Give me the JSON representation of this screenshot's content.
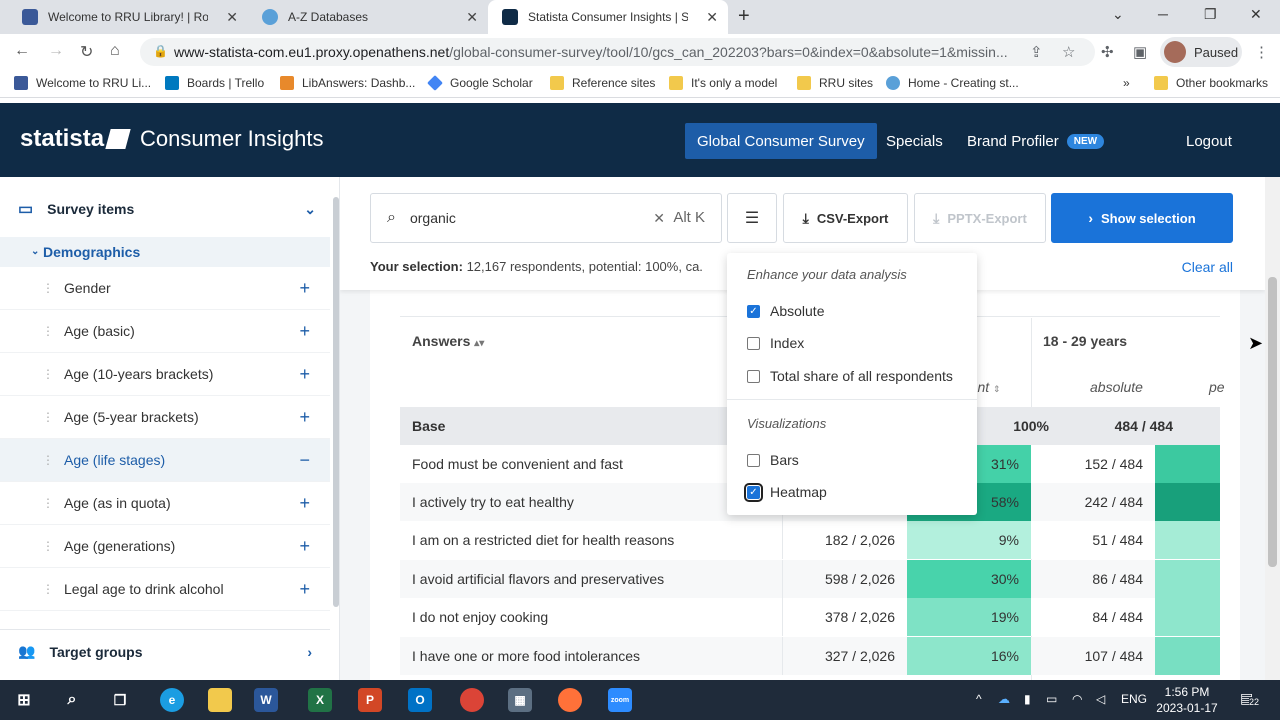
{
  "browser": {
    "tabs": [
      {
        "title": "Welcome to RRU Library! | Royal",
        "color": "#3b5998"
      },
      {
        "title": "A-Z Databases",
        "color": "#5aa0d8"
      },
      {
        "title": "Statista Consumer Insights | Stati",
        "color": "#0f2b46"
      }
    ],
    "url_domain": "www-statista-com.eu1.proxy.openathens.net",
    "url_path": "/global-consumer-survey/tool/10/gcs_can_202203?bars=0&index=0&absolute=1&missin...",
    "profile_label": "Paused",
    "bookmarks": [
      {
        "label": "Welcome to RRU Li...",
        "color": "#3b5998"
      },
      {
        "label": "Boards | Trello",
        "color": "#0079bf"
      },
      {
        "label": "LibAnswers: Dashb...",
        "color": "#e8892b"
      },
      {
        "label": "Google Scholar",
        "color": "#4285f4"
      },
      {
        "label": "Reference sites",
        "color": "#f2c94c"
      },
      {
        "label": "It's only a model",
        "color": "#f2c94c"
      },
      {
        "label": "RRU sites",
        "color": "#f2c94c"
      },
      {
        "label": "Home - Creating st...",
        "color": "#5aa0d8"
      }
    ],
    "more_bookmarks": "»",
    "other_bookmarks": "Other bookmarks"
  },
  "header": {
    "brand": "statista",
    "product": "Consumer Insights",
    "nav": [
      "Global Consumer Survey",
      "Specials",
      "Brand Profiler"
    ],
    "new_badge": "NEW",
    "logout": "Logout"
  },
  "sidebar": {
    "survey_items": "Survey items",
    "category": "Demographics",
    "items": [
      {
        "label": "Gender",
        "action": "+"
      },
      {
        "label": "Age (basic)",
        "action": "+"
      },
      {
        "label": "Age (10-years brackets)",
        "action": "+"
      },
      {
        "label": "Age (5-year brackets)",
        "action": "+"
      },
      {
        "label": "Age (life stages)",
        "action": "−"
      },
      {
        "label": "Age (as in quota)",
        "action": "+"
      },
      {
        "label": "Age (generations)",
        "action": "+"
      },
      {
        "label": "Legal age to drink alcohol",
        "action": "+"
      }
    ],
    "target_groups": "Target groups"
  },
  "toolbar": {
    "search_value": "organic",
    "shortcut": "Alt K",
    "csv": "CSV-Export",
    "pptx": "PPTX-Export",
    "show": "Show selection",
    "selection_label": "Your selection:",
    "selection_text": "12,167 respondents, potential: 100%, ca.",
    "clear_all": "Clear all"
  },
  "popup": {
    "heading1": "Enhance your data analysis",
    "options": [
      {
        "label": "Absolute",
        "checked": true
      },
      {
        "label": "Index",
        "checked": false
      },
      {
        "label": "Total share of all respondents",
        "checked": false
      }
    ],
    "heading2": "Visualizations",
    "viz": [
      {
        "label": "Bars",
        "checked": false
      },
      {
        "label": "Heatmap",
        "checked": true
      }
    ]
  },
  "table": {
    "answers_header": "Answers",
    "sort_icon": "sort-icon",
    "group_header": "18 - 29 years",
    "sub_percent_partial": "rcent",
    "sub_absolute": "absolute",
    "sub_percent_edge": "pe",
    "base_label": "Base",
    "base_percent": "100%",
    "base_group_abs": "484 / 484",
    "rows": [
      {
        "answer": "Food must be convenient and fast",
        "total_abs": "",
        "total_pct": "31%",
        "group_abs": "152 / 484",
        "heat": "#44d1a8",
        "group_heat": "#3cc9a0"
      },
      {
        "answer": "I actively try to eat healthy",
        "total_abs": "",
        "total_pct": "58%",
        "group_abs": "242 / 484",
        "heat": "#1aa982",
        "group_heat": "#18a07b"
      },
      {
        "answer": "I am on a restricted diet for health reasons",
        "total_abs": "182 / 2,026",
        "total_pct": "9%",
        "group_abs": "51 / 484",
        "heat": "#b3f0dd",
        "group_heat": "#a5ecd6"
      },
      {
        "answer": "I avoid artificial flavors and preservatives",
        "total_abs": "598 / 2,026",
        "total_pct": "30%",
        "group_abs": "86 / 484",
        "heat": "#48d3ab",
        "group_heat": "#8ee6cc"
      },
      {
        "answer": "I do not enjoy cooking",
        "total_abs": "378 / 2,026",
        "total_pct": "19%",
        "group_abs": "84 / 484",
        "heat": "#7ee2c5",
        "group_heat": "#8ee6cc"
      },
      {
        "answer": "I have one or more food intolerances",
        "total_abs": "327 / 2,026",
        "total_pct": "16%",
        "group_abs": "107 / 484",
        "heat": "#8de6cb",
        "group_heat": "#78dfc2"
      }
    ]
  },
  "taskbar": {
    "lang": "ENG",
    "time": "1:56 PM",
    "date": "2023-01-17",
    "notifications": "22"
  }
}
